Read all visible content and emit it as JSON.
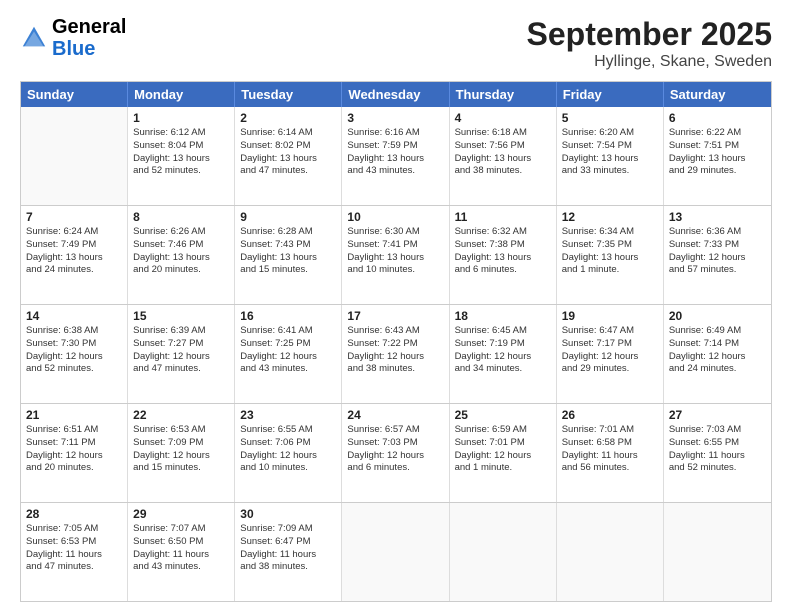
{
  "logo": {
    "line1": "General",
    "line2": "Blue"
  },
  "title": "September 2025",
  "subtitle": "Hyllinge, Skane, Sweden",
  "days_of_week": [
    "Sunday",
    "Monday",
    "Tuesday",
    "Wednesday",
    "Thursday",
    "Friday",
    "Saturday"
  ],
  "weeks": [
    [
      {
        "day": "",
        "lines": []
      },
      {
        "day": "1",
        "lines": [
          "Sunrise: 6:12 AM",
          "Sunset: 8:04 PM",
          "Daylight: 13 hours",
          "and 52 minutes."
        ]
      },
      {
        "day": "2",
        "lines": [
          "Sunrise: 6:14 AM",
          "Sunset: 8:02 PM",
          "Daylight: 13 hours",
          "and 47 minutes."
        ]
      },
      {
        "day": "3",
        "lines": [
          "Sunrise: 6:16 AM",
          "Sunset: 7:59 PM",
          "Daylight: 13 hours",
          "and 43 minutes."
        ]
      },
      {
        "day": "4",
        "lines": [
          "Sunrise: 6:18 AM",
          "Sunset: 7:56 PM",
          "Daylight: 13 hours",
          "and 38 minutes."
        ]
      },
      {
        "day": "5",
        "lines": [
          "Sunrise: 6:20 AM",
          "Sunset: 7:54 PM",
          "Daylight: 13 hours",
          "and 33 minutes."
        ]
      },
      {
        "day": "6",
        "lines": [
          "Sunrise: 6:22 AM",
          "Sunset: 7:51 PM",
          "Daylight: 13 hours",
          "and 29 minutes."
        ]
      }
    ],
    [
      {
        "day": "7",
        "lines": [
          "Sunrise: 6:24 AM",
          "Sunset: 7:49 PM",
          "Daylight: 13 hours",
          "and 24 minutes."
        ]
      },
      {
        "day": "8",
        "lines": [
          "Sunrise: 6:26 AM",
          "Sunset: 7:46 PM",
          "Daylight: 13 hours",
          "and 20 minutes."
        ]
      },
      {
        "day": "9",
        "lines": [
          "Sunrise: 6:28 AM",
          "Sunset: 7:43 PM",
          "Daylight: 13 hours",
          "and 15 minutes."
        ]
      },
      {
        "day": "10",
        "lines": [
          "Sunrise: 6:30 AM",
          "Sunset: 7:41 PM",
          "Daylight: 13 hours",
          "and 10 minutes."
        ]
      },
      {
        "day": "11",
        "lines": [
          "Sunrise: 6:32 AM",
          "Sunset: 7:38 PM",
          "Daylight: 13 hours",
          "and 6 minutes."
        ]
      },
      {
        "day": "12",
        "lines": [
          "Sunrise: 6:34 AM",
          "Sunset: 7:35 PM",
          "Daylight: 13 hours",
          "and 1 minute."
        ]
      },
      {
        "day": "13",
        "lines": [
          "Sunrise: 6:36 AM",
          "Sunset: 7:33 PM",
          "Daylight: 12 hours",
          "and 57 minutes."
        ]
      }
    ],
    [
      {
        "day": "14",
        "lines": [
          "Sunrise: 6:38 AM",
          "Sunset: 7:30 PM",
          "Daylight: 12 hours",
          "and 52 minutes."
        ]
      },
      {
        "day": "15",
        "lines": [
          "Sunrise: 6:39 AM",
          "Sunset: 7:27 PM",
          "Daylight: 12 hours",
          "and 47 minutes."
        ]
      },
      {
        "day": "16",
        "lines": [
          "Sunrise: 6:41 AM",
          "Sunset: 7:25 PM",
          "Daylight: 12 hours",
          "and 43 minutes."
        ]
      },
      {
        "day": "17",
        "lines": [
          "Sunrise: 6:43 AM",
          "Sunset: 7:22 PM",
          "Daylight: 12 hours",
          "and 38 minutes."
        ]
      },
      {
        "day": "18",
        "lines": [
          "Sunrise: 6:45 AM",
          "Sunset: 7:19 PM",
          "Daylight: 12 hours",
          "and 34 minutes."
        ]
      },
      {
        "day": "19",
        "lines": [
          "Sunrise: 6:47 AM",
          "Sunset: 7:17 PM",
          "Daylight: 12 hours",
          "and 29 minutes."
        ]
      },
      {
        "day": "20",
        "lines": [
          "Sunrise: 6:49 AM",
          "Sunset: 7:14 PM",
          "Daylight: 12 hours",
          "and 24 minutes."
        ]
      }
    ],
    [
      {
        "day": "21",
        "lines": [
          "Sunrise: 6:51 AM",
          "Sunset: 7:11 PM",
          "Daylight: 12 hours",
          "and 20 minutes."
        ]
      },
      {
        "day": "22",
        "lines": [
          "Sunrise: 6:53 AM",
          "Sunset: 7:09 PM",
          "Daylight: 12 hours",
          "and 15 minutes."
        ]
      },
      {
        "day": "23",
        "lines": [
          "Sunrise: 6:55 AM",
          "Sunset: 7:06 PM",
          "Daylight: 12 hours",
          "and 10 minutes."
        ]
      },
      {
        "day": "24",
        "lines": [
          "Sunrise: 6:57 AM",
          "Sunset: 7:03 PM",
          "Daylight: 12 hours",
          "and 6 minutes."
        ]
      },
      {
        "day": "25",
        "lines": [
          "Sunrise: 6:59 AM",
          "Sunset: 7:01 PM",
          "Daylight: 12 hours",
          "and 1 minute."
        ]
      },
      {
        "day": "26",
        "lines": [
          "Sunrise: 7:01 AM",
          "Sunset: 6:58 PM",
          "Daylight: 11 hours",
          "and 56 minutes."
        ]
      },
      {
        "day": "27",
        "lines": [
          "Sunrise: 7:03 AM",
          "Sunset: 6:55 PM",
          "Daylight: 11 hours",
          "and 52 minutes."
        ]
      }
    ],
    [
      {
        "day": "28",
        "lines": [
          "Sunrise: 7:05 AM",
          "Sunset: 6:53 PM",
          "Daylight: 11 hours",
          "and 47 minutes."
        ]
      },
      {
        "day": "29",
        "lines": [
          "Sunrise: 7:07 AM",
          "Sunset: 6:50 PM",
          "Daylight: 11 hours",
          "and 43 minutes."
        ]
      },
      {
        "day": "30",
        "lines": [
          "Sunrise: 7:09 AM",
          "Sunset: 6:47 PM",
          "Daylight: 11 hours",
          "and 38 minutes."
        ]
      },
      {
        "day": "",
        "lines": []
      },
      {
        "day": "",
        "lines": []
      },
      {
        "day": "",
        "lines": []
      },
      {
        "day": "",
        "lines": []
      }
    ]
  ]
}
